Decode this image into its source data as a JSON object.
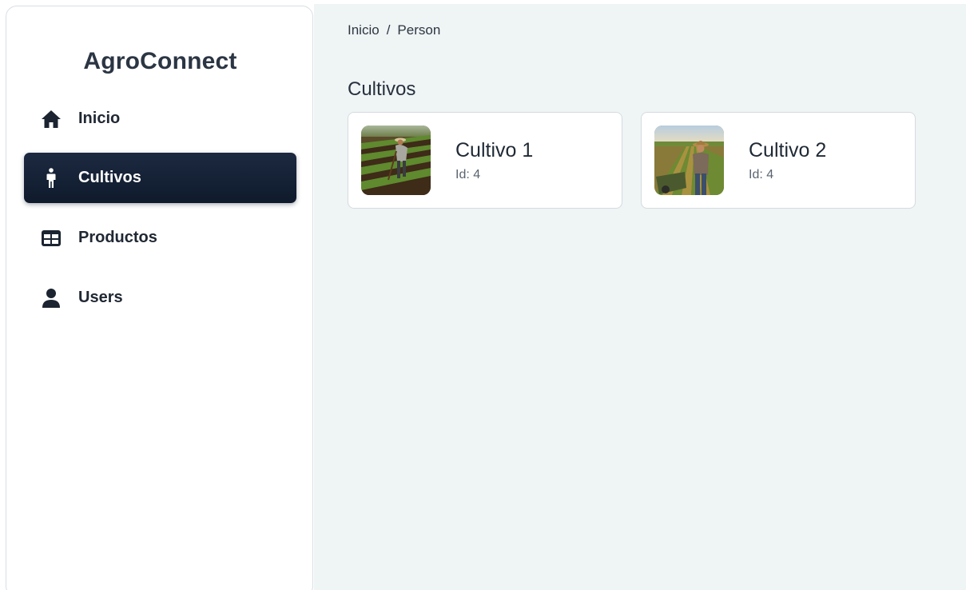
{
  "brand": {
    "name": "AgroConnect"
  },
  "sidebar": {
    "items": [
      {
        "label": "Inicio",
        "icon": "home-icon",
        "active": false
      },
      {
        "label": "Cultivos",
        "icon": "person-standing-icon",
        "active": true
      },
      {
        "label": "Productos",
        "icon": "table-grid-icon",
        "active": false
      },
      {
        "label": "Users",
        "icon": "user-icon",
        "active": false
      }
    ]
  },
  "breadcrumb": {
    "home": "Inicio",
    "separator": "/",
    "current": "Person"
  },
  "main": {
    "title": "Cultivos",
    "cards": [
      {
        "title": "Cultivo 1",
        "subtitle": "Id: 4",
        "image": "farmer-field-photo"
      },
      {
        "title": "Cultivo 2",
        "subtitle": "Id: 4",
        "image": "farmer-field-photo"
      }
    ]
  },
  "colors": {
    "active_nav_bg": "#111c30",
    "main_bg": "#eff4f5",
    "text_dark": "#202833"
  }
}
